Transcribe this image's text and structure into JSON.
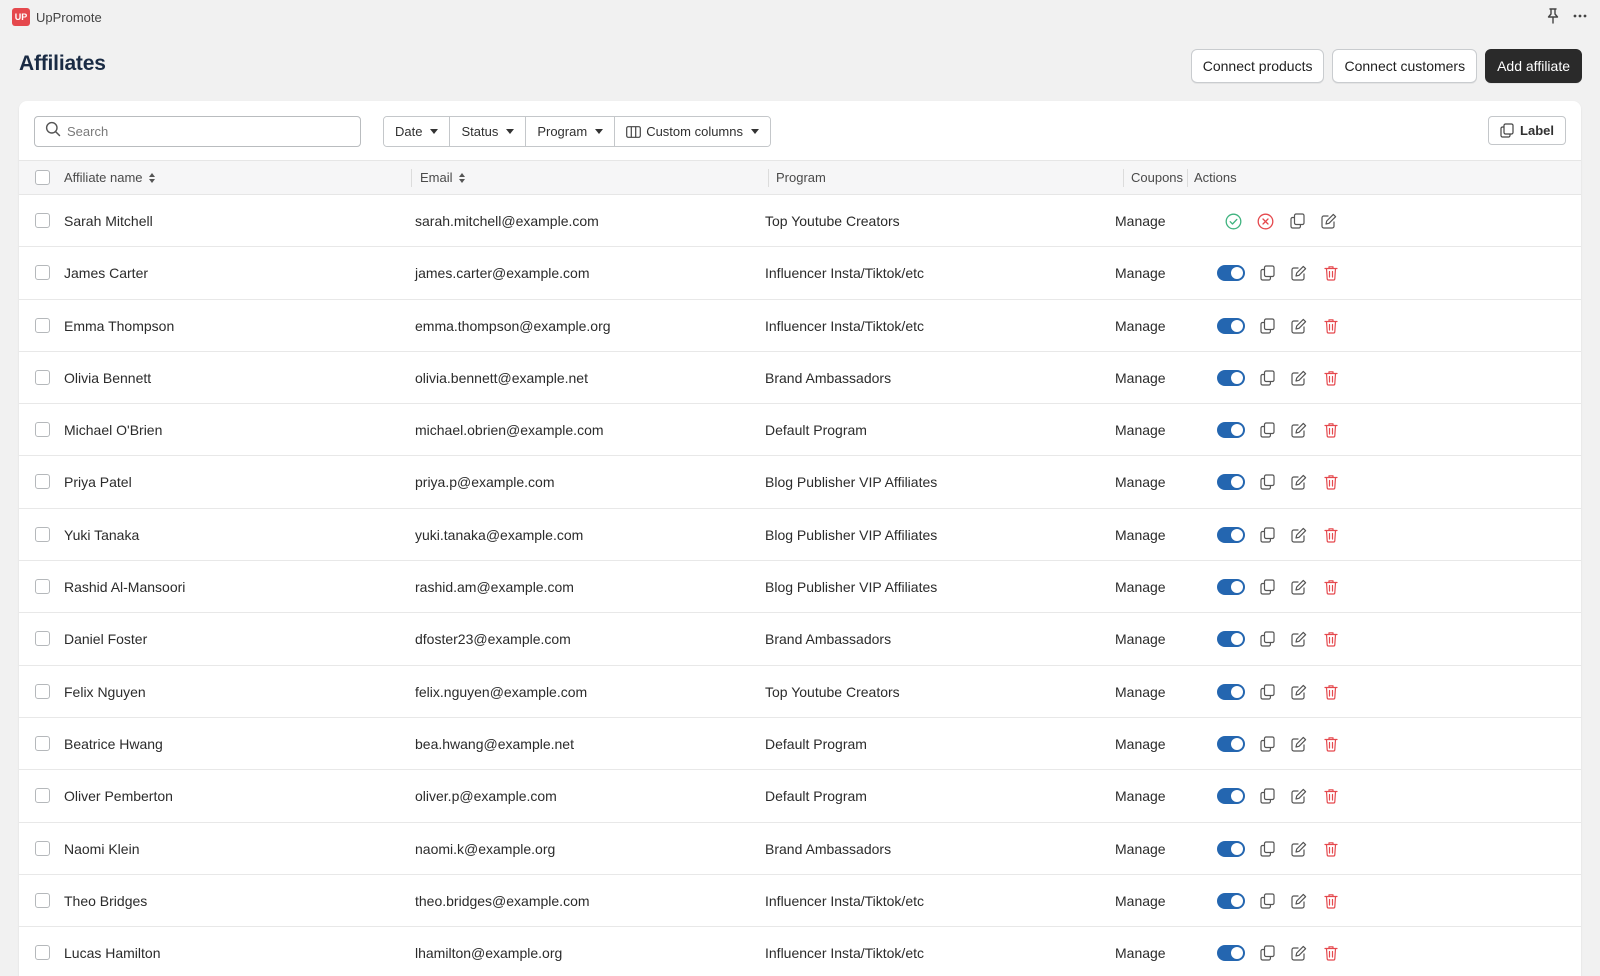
{
  "app": {
    "name": "UpPromote",
    "logo_text": "UP"
  },
  "page": {
    "title": "Affiliates"
  },
  "header_actions": {
    "connect_products": "Connect products",
    "connect_customers": "Connect customers",
    "add_affiliate": "Add affiliate"
  },
  "filters": {
    "search_placeholder": "Search",
    "date": "Date",
    "status": "Status",
    "program": "Program",
    "custom_columns": "Custom columns",
    "label": "Label"
  },
  "table": {
    "columns": {
      "name": "Affiliate name",
      "email": "Email",
      "program": "Program",
      "coupons": "Coupons",
      "actions": "Actions"
    },
    "manage_label": "Manage",
    "rows": [
      {
        "name": "Sarah Mitchell",
        "email": "sarah.mitchell@example.com",
        "program": "Top Youtube Creators",
        "coupons": "Manage",
        "state": "pending"
      },
      {
        "name": "James Carter",
        "email": "james.carter@example.com",
        "program": "Influencer Insta/Tiktok/etc",
        "coupons": "Manage",
        "state": "active"
      },
      {
        "name": "Emma Thompson",
        "email": "emma.thompson@example.org",
        "program": "Influencer Insta/Tiktok/etc",
        "coupons": "Manage",
        "state": "active"
      },
      {
        "name": "Olivia Bennett",
        "email": "olivia.bennett@example.net",
        "program": "Brand Ambassadors",
        "coupons": "Manage",
        "state": "active"
      },
      {
        "name": "Michael O'Brien",
        "email": "michael.obrien@example.com",
        "program": "Default Program",
        "coupons": "Manage",
        "state": "active"
      },
      {
        "name": "Priya Patel",
        "email": "priya.p@example.com",
        "program": "Blog Publisher VIP Affiliates",
        "coupons": "Manage",
        "state": "active"
      },
      {
        "name": "Yuki Tanaka",
        "email": "yuki.tanaka@example.com",
        "program": "Blog Publisher VIP Affiliates",
        "coupons": "Manage",
        "state": "active"
      },
      {
        "name": "Rashid Al-Mansoori",
        "email": "rashid.am@example.com",
        "program": "Blog Publisher VIP Affiliates",
        "coupons": "Manage",
        "state": "active"
      },
      {
        "name": "Daniel Foster",
        "email": "dfoster23@example.com",
        "program": "Brand Ambassadors",
        "coupons": "Manage",
        "state": "active"
      },
      {
        "name": "Felix Nguyen",
        "email": "felix.nguyen@example.com",
        "program": "Top Youtube Creators",
        "coupons": "Manage",
        "state": "active"
      },
      {
        "name": "Beatrice Hwang",
        "email": "bea.hwang@example.net",
        "program": "Default Program",
        "coupons": "Manage",
        "state": "active"
      },
      {
        "name": "Oliver Pemberton",
        "email": "oliver.p@example.com",
        "program": "Default Program",
        "coupons": "Manage",
        "state": "active"
      },
      {
        "name": "Naomi Klein",
        "email": "naomi.k@example.org",
        "program": "Brand Ambassadors",
        "coupons": "Manage",
        "state": "active"
      },
      {
        "name": "Theo Bridges",
        "email": "theo.bridges@example.com",
        "program": "Influencer Insta/Tiktok/etc",
        "coupons": "Manage",
        "state": "active"
      },
      {
        "name": "Lucas Hamilton",
        "email": "lhamilton@example.org",
        "program": "Influencer Insta/Tiktok/etc",
        "coupons": "Manage",
        "state": "active"
      }
    ]
  },
  "colors": {
    "toggle_on": "#2466b0",
    "approve": "#3fb37f",
    "reject": "#e5484d",
    "delete": "#e5484d",
    "primary_button": "#2a2a2a"
  }
}
